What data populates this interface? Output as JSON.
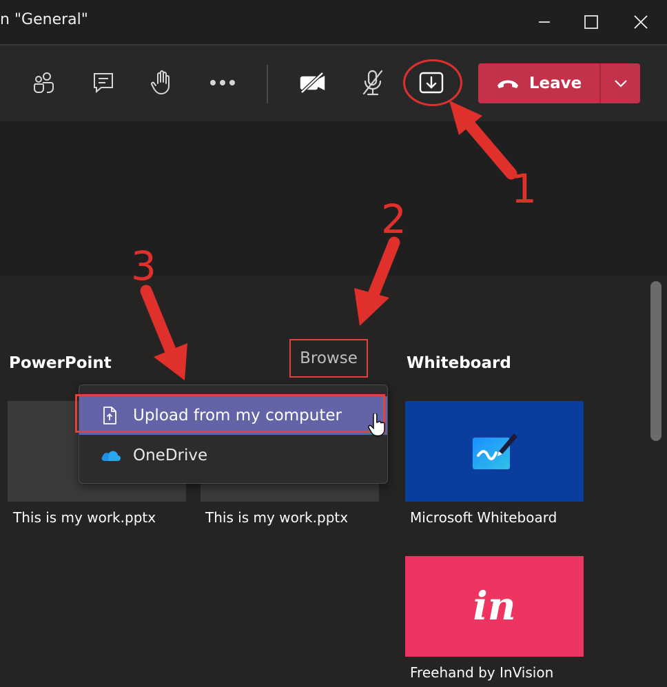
{
  "window": {
    "title": "n \"General\"",
    "minimize_icon": "minimize-icon",
    "maximize_icon": "maximize-icon",
    "close_icon": "close-icon"
  },
  "toolbar": {
    "icons": [
      "participants-icon",
      "chat-icon",
      "raise-hand-icon",
      "more-options-icon",
      "camera-off-icon",
      "mic-off-icon",
      "share-content-icon"
    ],
    "leave_label": "Leave"
  },
  "share_tray": {
    "powerpoint_heading": "PowerPoint",
    "browse_label": "Browse",
    "whiteboard_heading": "Whiteboard",
    "files": [
      {
        "caption": "This is my work.pptx"
      },
      {
        "caption": "This is my work.pptx"
      }
    ],
    "whiteboards": [
      {
        "caption": "Microsoft Whiteboard",
        "color": "#0b3d9e"
      },
      {
        "caption": "Freehand by InVision",
        "color": "#ee3562",
        "logo_text": "in"
      }
    ]
  },
  "browse_menu": {
    "items": [
      {
        "label": "Upload from my computer",
        "icon": "upload-file-icon",
        "selected": true
      },
      {
        "label": "OneDrive",
        "icon": "onedrive-icon",
        "selected": false
      }
    ]
  },
  "annotations": {
    "step1": "1",
    "step2": "2",
    "step3": "3",
    "color": "#e0302c"
  },
  "colors": {
    "leave": "#c4314b",
    "selected_item": "#6264a7"
  }
}
